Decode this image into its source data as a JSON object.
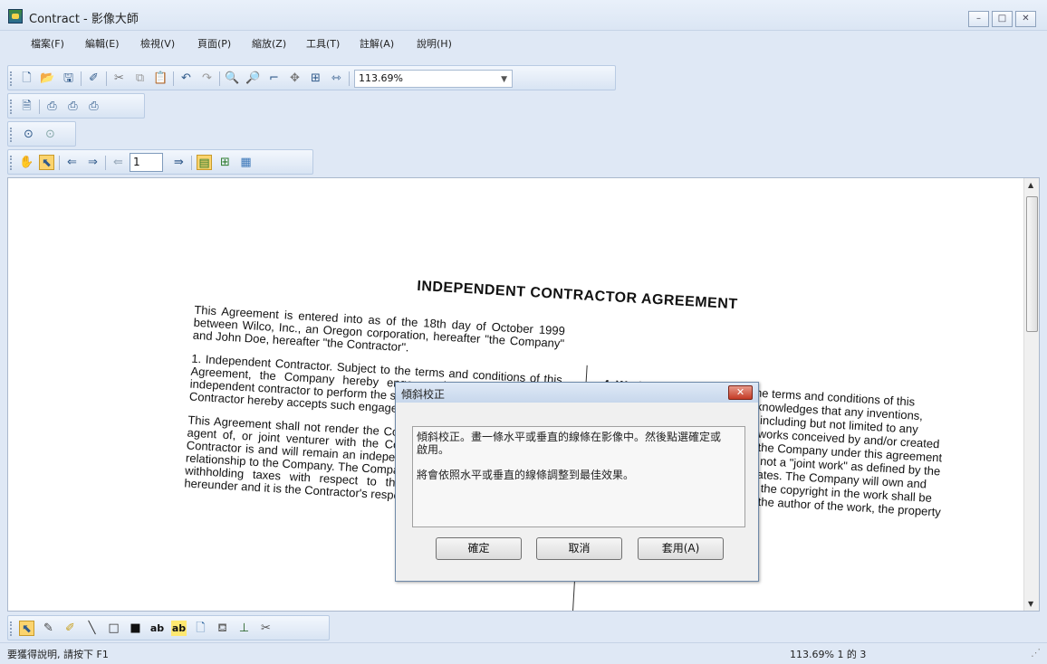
{
  "window": {
    "title": "Contract - 影像大師",
    "minimize": "–",
    "maximize": "□",
    "close": "✕"
  },
  "menu": [
    "檔案(F)",
    "編輯(E)",
    "檢視(V)",
    "頁面(P)",
    "縮放(Z)",
    "工具(T)",
    "註解(A)",
    "說明(H)"
  ],
  "toolbar1": {
    "zoom_value": "113.69%",
    "icons": [
      "new-icon",
      "open-icon",
      "save-icon",
      "eraser-icon",
      "cut-icon",
      "copy-icon",
      "paste-icon",
      "undo-icon",
      "redo-icon",
      "zoom-in-icon",
      "zoom-out-icon",
      "zoom-select-icon",
      "pan-icon",
      "fit-page-icon",
      "fit-width-icon"
    ]
  },
  "toolbar2": {
    "icons": [
      "print-preview-icon",
      "print-icon",
      "print-setup-icon",
      "print-current-icon"
    ]
  },
  "toolbar3": {
    "icons": [
      "rotate-left-icon",
      "rotate-right-icon"
    ]
  },
  "toolbar4": {
    "page_number": "1",
    "icons": [
      "hand-icon",
      "select-arrow-icon",
      "prev-image-icon",
      "next-image-icon",
      "prev-page-icon",
      "next-page-icon",
      "single-page-icon",
      "multi-page-icon",
      "thumbnail-icon"
    ]
  },
  "document": {
    "title": "INDEPENDENT CONTRACTOR AGREEMENT",
    "intro": "This Agreement is entered into as of the 18th day of October 1999 between Wilco, Inc., an Oregon corporation, hereafter \"the Company\" and John Doe, hereafter \"the Contractor\".",
    "section1": "1. Independent Contractor. Subject to the terms and conditions of this Agreement, the Company hereby engages the Contractor as an independent contractor to perform the services set forth herein, and the Contractor hereby accepts such engagement.",
    "section1b": "This Agreement shall not render the Contractor an employee, partner, agent of, or joint venturer with the Company for any purpose. The Contractor is and will remain an independent contractor in (his or her) relationship to the Company. The Company shall not be responsible for withholding taxes with respect to the Contractor's compensation hereunder and it is the Contractor's responsibility to ...",
    "section4_heading": "4. Work for Hire.",
    "section4": "Subject to the terms and conditions of this Agreement, the Contractor acknowledges that any inventions, discoveries, development and including but not limited to any visual, multi-media interactive works conceived by and/or created by the engagement relative to the Company under this agreement are \"works made for hire\", and not a \"joint work\" as defined by the copyright laws of the United States. The Company will own and retain all the exclusive rights in the copyright in the work shall be performed by the Company as the author of the work, the property of the Contractor ..."
  },
  "dialog": {
    "title": "傾斜校正",
    "text": "傾斜校正。畫一條水平或垂直的線條在影像中。然後點選確定或\n啟用。\n\n將會依照水平或垂直的線條調整到最佳效果。",
    "ok": "確定",
    "cancel": "取消",
    "apply": "套用(A)"
  },
  "annotation_toolbar": {
    "icons": [
      "select-arrow-icon",
      "highlighter-icon",
      "marker-icon",
      "line-icon",
      "hollow-rect-icon",
      "filled-rect-icon",
      "text-icon",
      "text-highlight-icon",
      "note-icon",
      "stamp-icon",
      "pushpin-icon",
      "crop-icon"
    ],
    "text_label": "ab",
    "text_highlight_label": "ab"
  },
  "status": {
    "help": "要獲得說明, 請按下 F1",
    "zoom_page": "113.69% 1 的 3"
  },
  "colors": {
    "accent": "#3a6ea5",
    "dialog_close": "#c43a25",
    "toolbar": "#dbe6f4"
  }
}
